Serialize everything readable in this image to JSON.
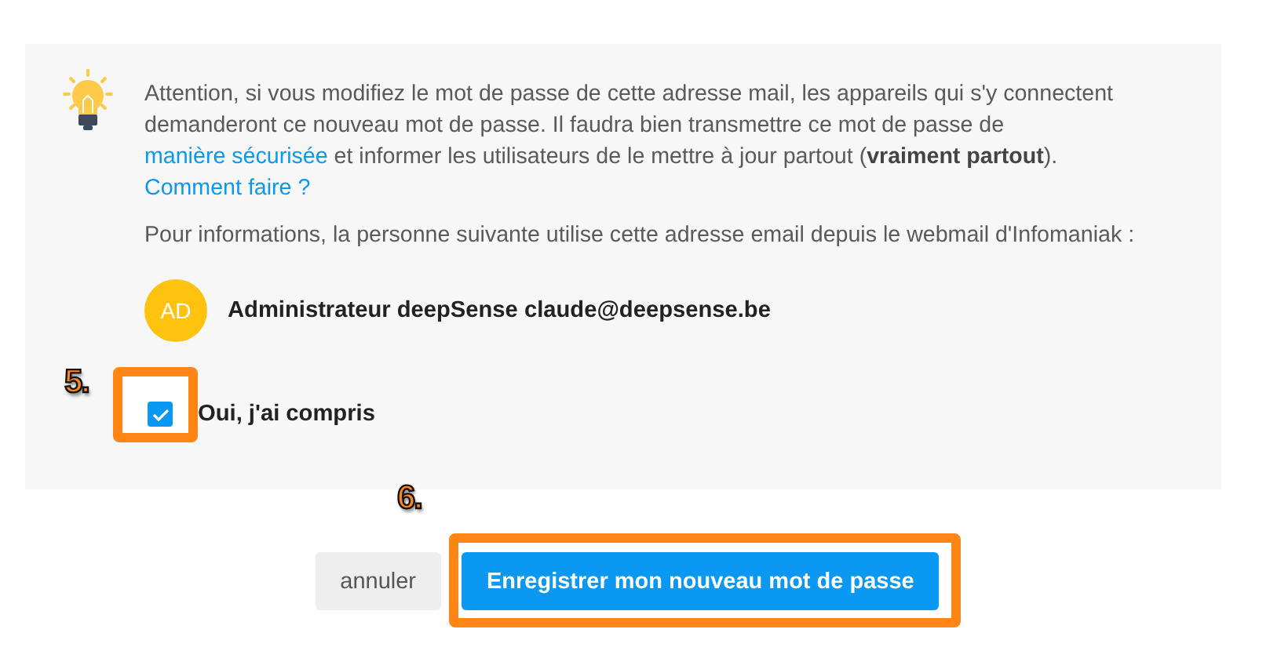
{
  "notice": {
    "paragraphs": [
      [
        {
          "kind": "text",
          "text": "Attention, si vous modifiez le mot de passe de cette adresse mail, les appareils qui s'y connectent demanderont ce nouveau mot de passe. Il faudra bien transmettre ce mot de passe de "
        },
        {
          "kind": "link",
          "text": "manière sécurisée"
        },
        {
          "kind": "text",
          "text": " et informer les utilisateurs de le mettre à jour partout (**vraiment partout**). "
        },
        {
          "kind": "link",
          "text": "Comment faire ?"
        }
      ],
      [
        {
          "kind": "text",
          "text": "Pour informations, la personne suivante utilise cette adresse email depuis le webmail d'Infomaniak :"
        }
      ]
    ]
  },
  "user": {
    "initials": "AD",
    "name": "Administrateur deepSense claude@deepsense.be"
  },
  "confirm": {
    "label": "Oui, j'ai compris",
    "checked": true,
    "callout": "5."
  },
  "buttons": [
    {
      "label": "annuler",
      "kind": "secondary"
    },
    {
      "label": "Enregistrer mon nouveau mot de passe",
      "kind": "primary",
      "callout": "6."
    }
  ]
}
